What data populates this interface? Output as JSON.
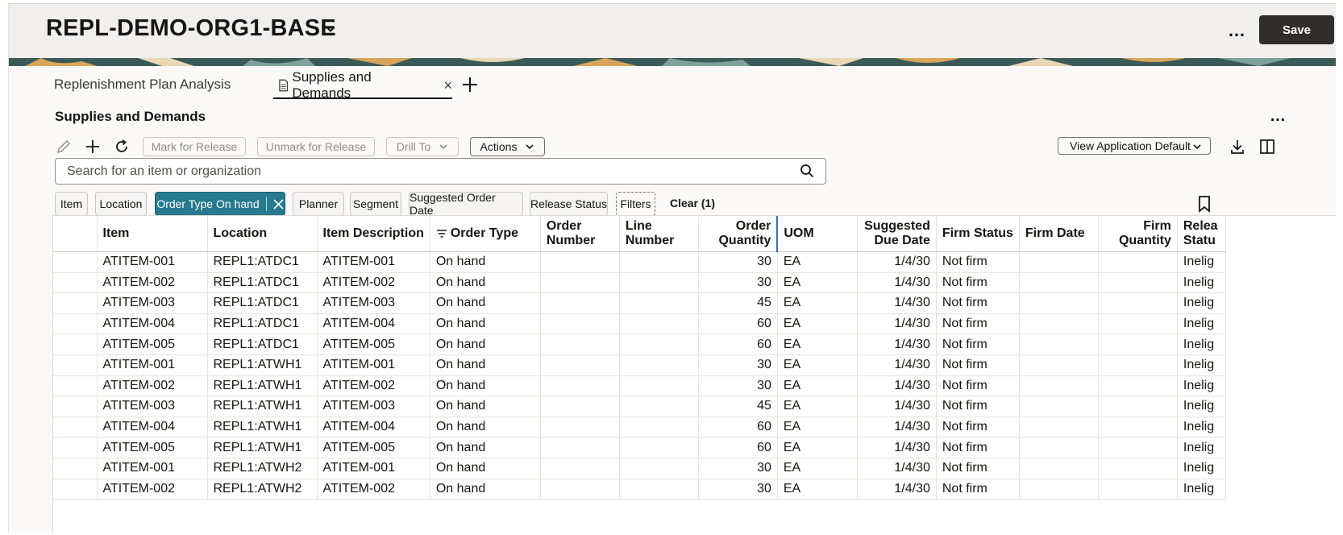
{
  "header": {
    "title": "REPL-DEMO-ORG1-BASE",
    "save_label": "Save",
    "more_label": "…"
  },
  "tabs": [
    {
      "label": "Replenishment Plan Analysis"
    },
    {
      "label": "Supplies and Demands",
      "close": "×"
    }
  ],
  "section": {
    "title": "Supplies and Demands",
    "more_label": "…"
  },
  "toolbar": {
    "mark_label": "Mark for Release",
    "unmark_label": "Unmark for Release",
    "drill_label": "Drill To",
    "actions_label": "Actions",
    "view_label": "View Application Default"
  },
  "search": {
    "placeholder": "Search for an item or organization"
  },
  "filters": {
    "chips": [
      "Item",
      "Location",
      "Order Type On hand",
      "Planner",
      "Segment",
      "Suggested Order Date",
      "Release Status",
      "Filters",
      "Clear (1)"
    ]
  },
  "table": {
    "columns": [
      "",
      "Item",
      "Location",
      "Item Description",
      "Order Type",
      "Order\nNumber",
      "Line\nNumber",
      "Order\nQuantity",
      "UOM",
      "Suggested\nDue Date",
      "Firm Status",
      "Firm Date",
      "Firm\nQuantity",
      "Relea\nStatu"
    ],
    "rows": [
      [
        "ATITEM-001",
        "REPL1:ATDC1",
        "ATITEM-001",
        "On hand",
        "",
        "",
        "30",
        "EA",
        "1/4/30",
        "Not firm",
        "",
        "",
        "Inelig"
      ],
      [
        "ATITEM-002",
        "REPL1:ATDC1",
        "ATITEM-002",
        "On hand",
        "",
        "",
        "30",
        "EA",
        "1/4/30",
        "Not firm",
        "",
        "",
        "Inelig"
      ],
      [
        "ATITEM-003",
        "REPL1:ATDC1",
        "ATITEM-003",
        "On hand",
        "",
        "",
        "45",
        "EA",
        "1/4/30",
        "Not firm",
        "",
        "",
        "Inelig"
      ],
      [
        "ATITEM-004",
        "REPL1:ATDC1",
        "ATITEM-004",
        "On hand",
        "",
        "",
        "60",
        "EA",
        "1/4/30",
        "Not firm",
        "",
        "",
        "Inelig"
      ],
      [
        "ATITEM-005",
        "REPL1:ATDC1",
        "ATITEM-005",
        "On hand",
        "",
        "",
        "60",
        "EA",
        "1/4/30",
        "Not firm",
        "",
        "",
        "Inelig"
      ],
      [
        "ATITEM-001",
        "REPL1:ATWH1",
        "ATITEM-001",
        "On hand",
        "",
        "",
        "30",
        "EA",
        "1/4/30",
        "Not firm",
        "",
        "",
        "Inelig"
      ],
      [
        "ATITEM-002",
        "REPL1:ATWH1",
        "ATITEM-002",
        "On hand",
        "",
        "",
        "30",
        "EA",
        "1/4/30",
        "Not firm",
        "",
        "",
        "Inelig"
      ],
      [
        "ATITEM-003",
        "REPL1:ATWH1",
        "ATITEM-003",
        "On hand",
        "",
        "",
        "45",
        "EA",
        "1/4/30",
        "Not firm",
        "",
        "",
        "Inelig"
      ],
      [
        "ATITEM-004",
        "REPL1:ATWH1",
        "ATITEM-004",
        "On hand",
        "",
        "",
        "60",
        "EA",
        "1/4/30",
        "Not firm",
        "",
        "",
        "Inelig"
      ],
      [
        "ATITEM-005",
        "REPL1:ATWH1",
        "ATITEM-005",
        "On hand",
        "",
        "",
        "60",
        "EA",
        "1/4/30",
        "Not firm",
        "",
        "",
        "Inelig"
      ],
      [
        "ATITEM-001",
        "REPL1:ATWH2",
        "ATITEM-001",
        "On hand",
        "",
        "",
        "30",
        "EA",
        "1/4/30",
        "Not firm",
        "",
        "",
        "Inelig"
      ],
      [
        "ATITEM-002",
        "REPL1:ATWH2",
        "ATITEM-002",
        "On hand",
        "",
        "",
        "30",
        "EA",
        "1/4/30",
        "Not firm",
        "",
        "",
        "Inelig"
      ]
    ]
  },
  "icons": {
    "edit": "pencil-icon",
    "add": "plus-icon",
    "refresh": "refresh-icon",
    "download": "download-icon",
    "columns": "split-view-icon",
    "search": "search-icon",
    "bookmark": "bookmark-icon"
  },
  "colors": {
    "active_chip": "#277a8e",
    "save_button": "#312d2a",
    "banner": "#3c5a57"
  }
}
